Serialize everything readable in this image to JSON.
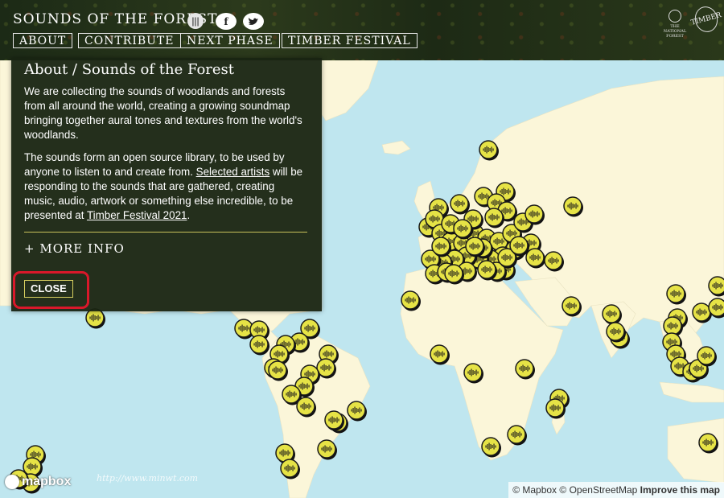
{
  "header": {
    "title": "SOUNDS OF THE FOREST",
    "icons": [
      "sound-icon",
      "facebook-icon",
      "twitter-icon"
    ],
    "nav": [
      "ABOUT",
      "CONTRIBUTE",
      "NEXT PHASE",
      "TIMBER FESTIVAL"
    ],
    "partner_logo": "THE NATIONAL FOREST",
    "festival_logo": "TIMBER"
  },
  "about": {
    "title": "About / Sounds of the Forest",
    "para1": "We are collecting the sounds of woodlands and forests from all around the world, creating a growing soundmap bringing together aural tones and textures from the world's woodlands.",
    "para2_a": "The sounds form an open source library, to be used by anyone to listen to and create from. ",
    "para2_link1": "Selected artists",
    "para2_b": " will be responding to the sounds that are gathered, creating music, audio, artwork or something else incredible, to be presented at ",
    "para2_link2": "Timber Festival 2021",
    "para2_c": ".",
    "more": "+ MORE INFO",
    "close": "CLOSE"
  },
  "footer": {
    "mapbox_logo": "mapbox",
    "attrib_mapbox": "© Mapbox",
    "attrib_osm": "© OpenStreetMap",
    "improve": "Improve this map",
    "watermark": "http://www.minwt.com"
  },
  "colors": {
    "water": "#bfe6ef",
    "land": "#fbf6d9",
    "pin_fill": "#e6e346",
    "pin_border": "#1a1a1a",
    "panel": "#182412"
  }
}
